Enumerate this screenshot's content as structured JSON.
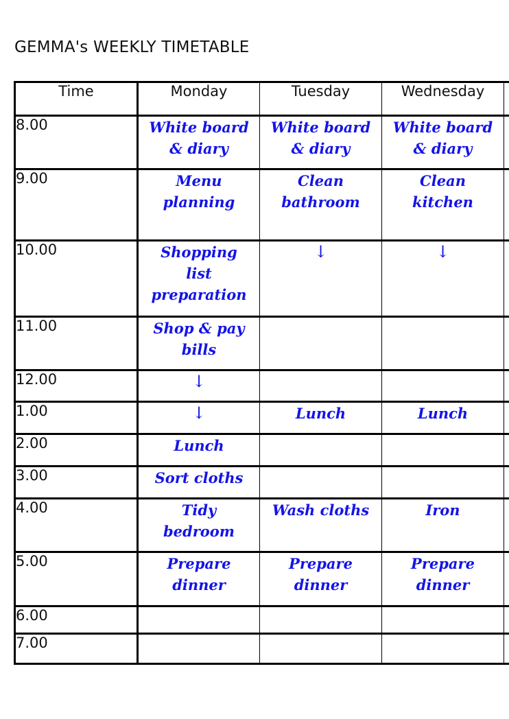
{
  "title": "GEMMA's WEEKLY TIMETABLE",
  "table": {
    "headers": [
      "Time",
      "Monday",
      "Tuesday",
      "Wednesday",
      ""
    ],
    "rows": [
      {
        "time": "8.00",
        "monday": "White board\n& diary",
        "tuesday": "White board\n& diary",
        "wednesday": "White board\n& diary"
      },
      {
        "time": "9.00",
        "monday": "Menu\nplanning",
        "tuesday": "Clean\nbathroom",
        "wednesday": "Clean\nkitchen"
      },
      {
        "time": "10.00",
        "monday": "Shopping\nlist\npreparation",
        "tuesday": "↓",
        "wednesday": "↓"
      },
      {
        "time": "11.00",
        "monday": "Shop & pay\nbills",
        "tuesday": "",
        "wednesday": ""
      },
      {
        "time": "12.00",
        "monday": "↓",
        "tuesday": "",
        "wednesday": ""
      },
      {
        "time": "1.00",
        "monday": "↓",
        "tuesday": "Lunch",
        "wednesday": "Lunch"
      },
      {
        "time": "2.00",
        "monday": "Lunch",
        "tuesday": "",
        "wednesday": ""
      },
      {
        "time": "3.00",
        "monday": "Sort cloths",
        "tuesday": "",
        "wednesday": ""
      },
      {
        "time": "4.00",
        "monday": "Tidy\nbedroom",
        "tuesday": "Wash cloths",
        "wednesday": "Iron"
      },
      {
        "time": "5.00",
        "monday": "Prepare\ndinner",
        "tuesday": "Prepare\ndinner",
        "wednesday": "Prepare\ndinner"
      },
      {
        "time": "6.00",
        "monday": "",
        "tuesday": "",
        "wednesday": ""
      },
      {
        "time": "7.00",
        "monday": "",
        "tuesday": "",
        "wednesday": ""
      }
    ]
  },
  "colors": {
    "handwriting": "#1414e6",
    "text": "#111111",
    "lines": "#000000"
  }
}
